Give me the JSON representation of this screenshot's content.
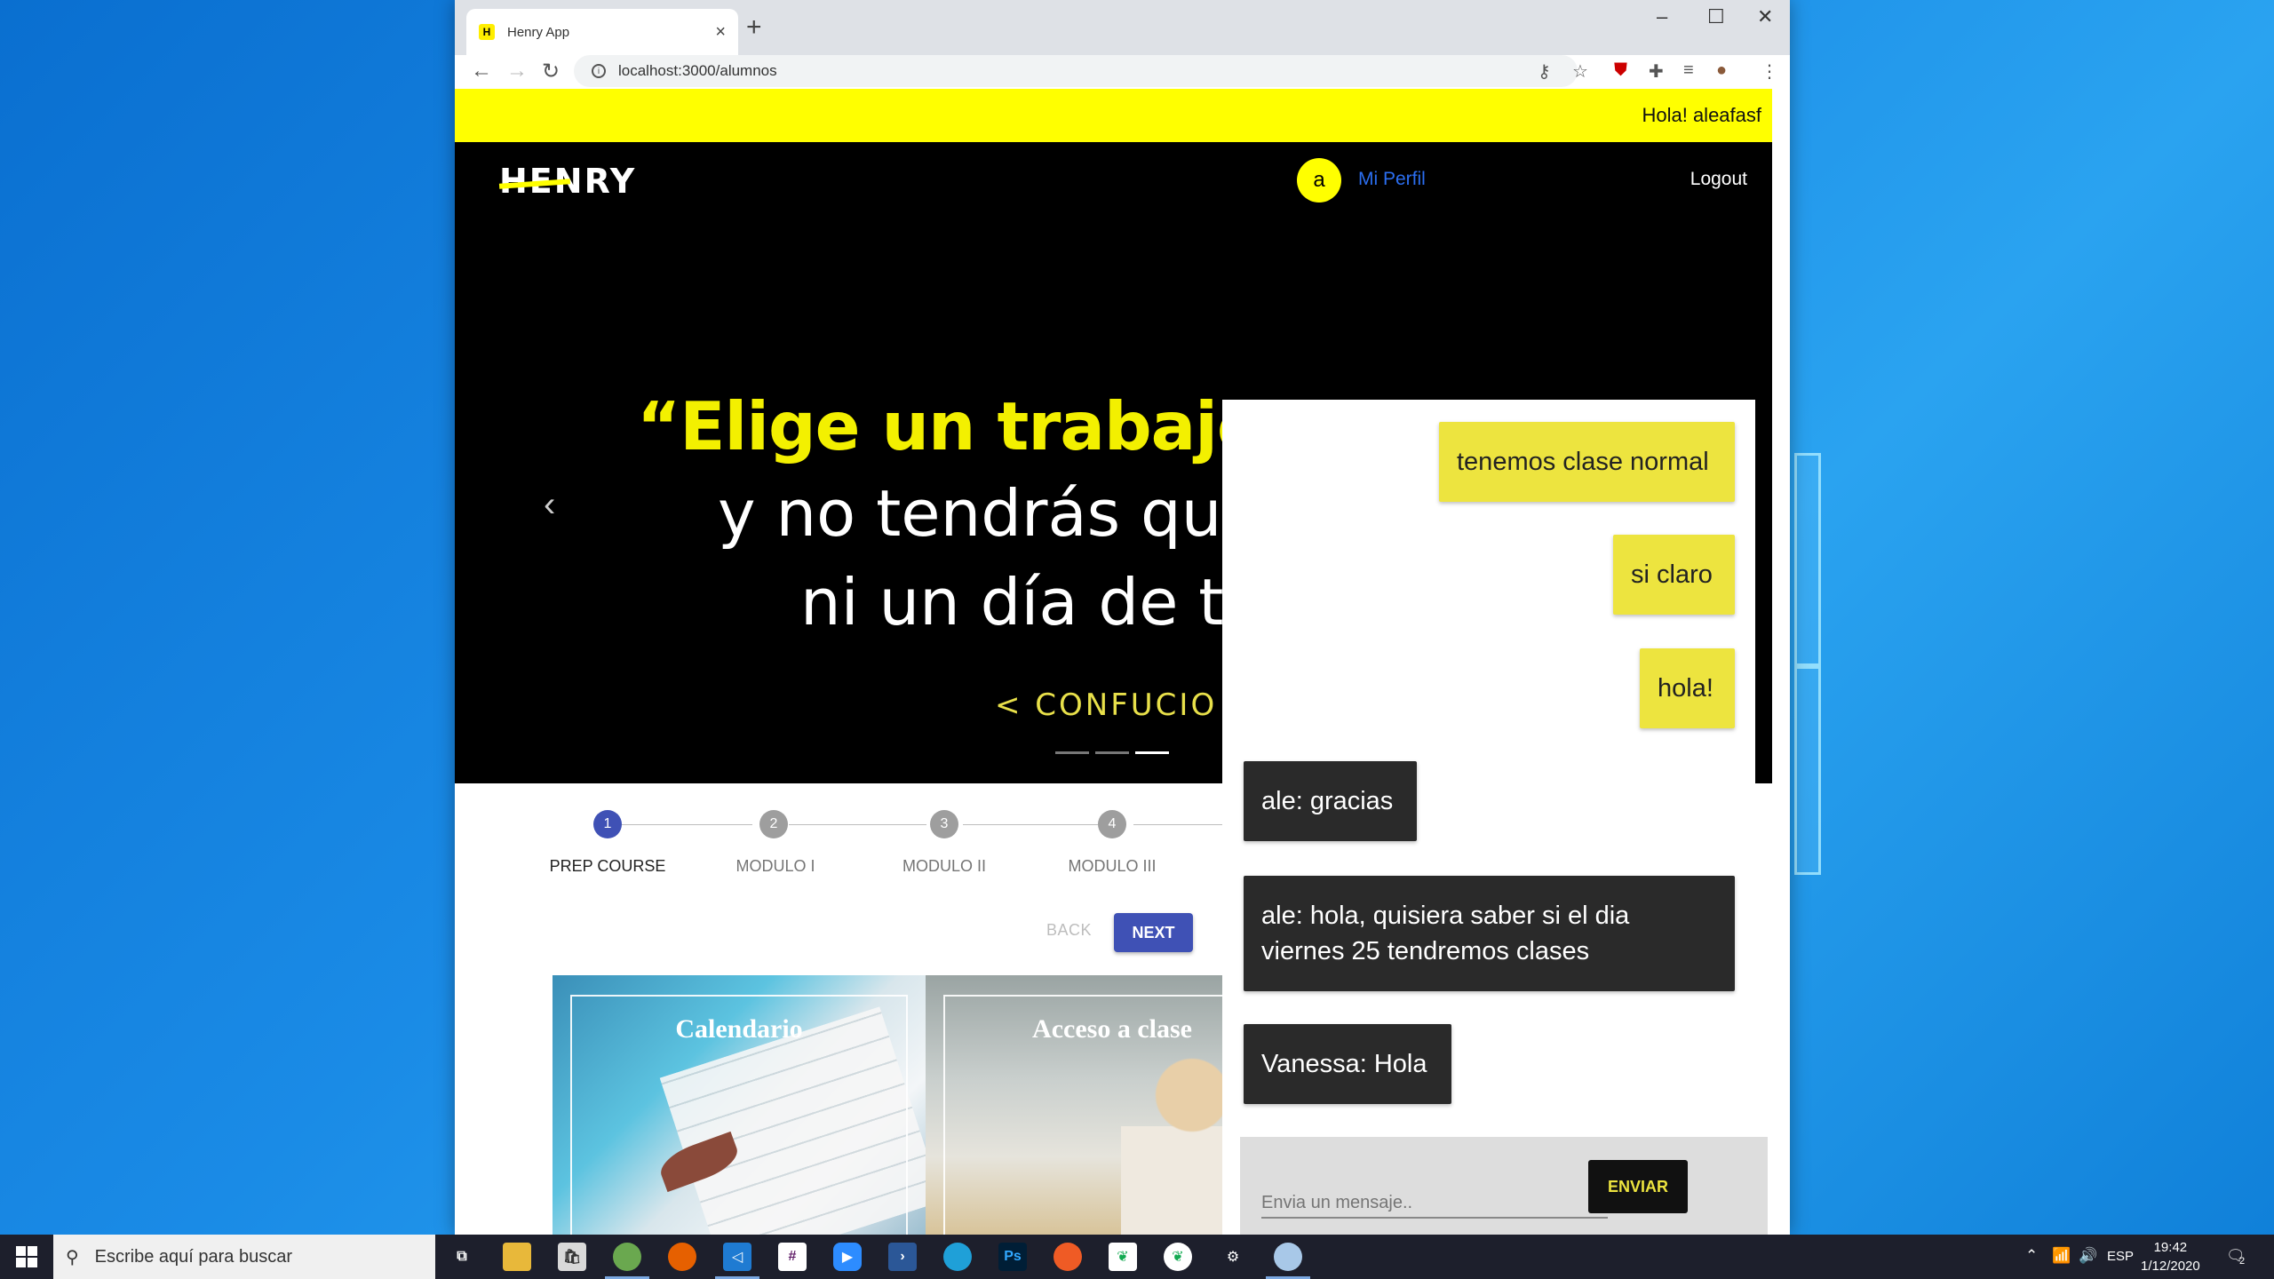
{
  "browser": {
    "tab_title": "Henry App",
    "url": "localhost:3000/alumnos"
  },
  "page": {
    "greeting": "Hola! aleafasf",
    "logo": "HENRY",
    "avatar_letter": "a",
    "profile_link": "Mi Perfil",
    "logout": "Logout"
  },
  "hero": {
    "line1": "“Elige un trabajo que te guste",
    "line2": "y no tendrás que",
    "line3": "ni un día de tu",
    "author": "< CONFUCIO >"
  },
  "stepper": {
    "steps": [
      {
        "number": "1",
        "label": "PREP COURSE"
      },
      {
        "number": "2",
        "label": "MODULO I"
      },
      {
        "number": "3",
        "label": "MODULO II"
      },
      {
        "number": "4",
        "label": "MODULO III"
      }
    ],
    "back": "BACK",
    "next": "NEXT"
  },
  "cards": [
    {
      "title": "Calendario"
    },
    {
      "title": "Acceso a clase"
    }
  ],
  "chat": {
    "messages": [
      {
        "text": "tenemos clase normal",
        "mine": true
      },
      {
        "text": "si claro",
        "mine": true
      },
      {
        "text": "hola!",
        "mine": true
      },
      {
        "text": "ale: gracias",
        "mine": false
      },
      {
        "text": "ale: hola, quisiera saber si el dia viernes 25 tendremos clases",
        "mine": false
      },
      {
        "text": "Vanessa: Hola",
        "mine": false
      }
    ],
    "input_placeholder": "Envia un mensaje..",
    "send_label": "ENVIAR"
  },
  "taskbar": {
    "search_placeholder": "Escribe aquí para buscar",
    "language": "ESP",
    "time": "19:42",
    "date": "1/12/2020",
    "notification_count": "2"
  },
  "colors": {
    "brand_yellow": "#ffff00",
    "chat_mine": "#ede43f",
    "chat_other": "#2a2a2a",
    "stepper_active": "#3f51b5"
  }
}
